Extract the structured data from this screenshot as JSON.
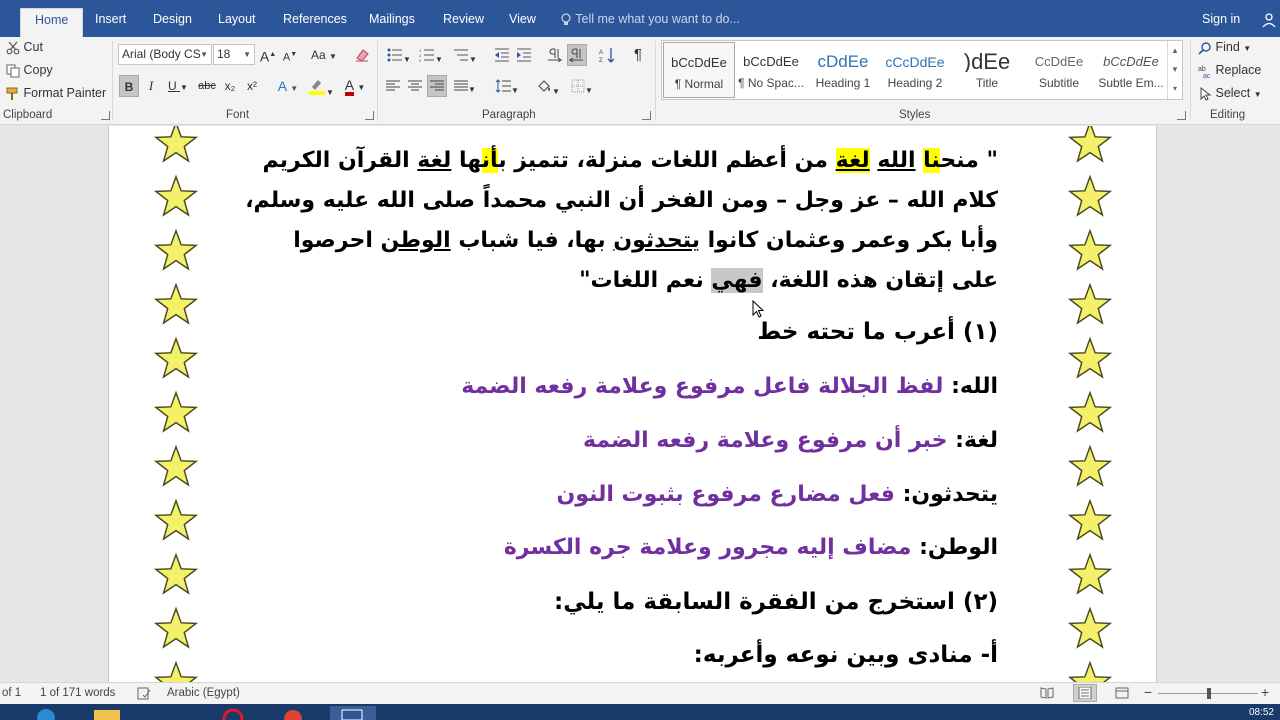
{
  "tabs": [
    {
      "label": "Home",
      "active": true
    },
    {
      "label": "Insert"
    },
    {
      "label": "Design"
    },
    {
      "label": "Layout"
    },
    {
      "label": "References"
    },
    {
      "label": "Mailings"
    },
    {
      "label": "Review"
    },
    {
      "label": "View"
    }
  ],
  "tell_me": "Tell me what you want to do...",
  "sign_in": "Sign in",
  "clipboard": {
    "cut": "Cut",
    "copy": "Copy",
    "format_painter": "Format Painter",
    "label": "Clipboard"
  },
  "font": {
    "name": "Arial (Body CS",
    "size": "18",
    "label": "Font",
    "bold": "B",
    "italic": "I",
    "underline": "U",
    "strike": "abc",
    "subscript": "x₂",
    "superscript": "x²",
    "case": "Aa",
    "grow": "A",
    "shrink": "A",
    "effects": "A",
    "color": "A",
    "highlight_color": "#ffff00",
    "font_color": "#c00000"
  },
  "paragraph": {
    "label": "Paragraph",
    "pilcrow": "¶"
  },
  "styles": {
    "label": "Styles",
    "items": [
      {
        "sample": "bCcDdEe",
        "name": "¶ Normal",
        "selected": true
      },
      {
        "sample": "bCcDdEe",
        "name": "¶ No Spac..."
      },
      {
        "sample": "cDdEe",
        "name": "Heading 1"
      },
      {
        "sample": "cCcDdEe",
        "name": "Heading 2"
      },
      {
        "sample": ")dEe",
        "name": "Title"
      },
      {
        "sample": "CcDdEe",
        "name": "Subtitle"
      },
      {
        "sample": "bCcDdEe",
        "name": "Subtle Em..."
      }
    ]
  },
  "editing": {
    "find": "Find",
    "replace": "Replace",
    "select": "Select",
    "label": "Editing"
  },
  "document": {
    "para1": [
      "\" منحنا الله لغة من أعظم اللغات منزلة، تتميز بأنها لغة القرآن الكريم",
      "كلام الله – عز وجل – ومن الفخر أن النبي محمداً صلى الله عليه وسلم،",
      "وأبا بكر وعمر وعثمان كانوا يتحدثون بها، فيا شباب الوطن احرصوا",
      "على إتقان هذه اللغة، فهي نعم اللغات\""
    ],
    "q1": "(١) أعرب ما تحته خط",
    "answers": [
      {
        "word": "الله:",
        "desc": "لفظ الجلالة فاعل مرفوع وعلامة رفعه الضمة"
      },
      {
        "word": "لغة:",
        "desc": "خبر أن مرفوع وعلامة رفعه الضمة"
      },
      {
        "word": "يتحدثون:",
        "desc": "فعل مضارع مرفوع بثبوت النون"
      },
      {
        "word": "الوطن:",
        "desc": "مضاف إليه مجرور وعلامة جره الكسرة"
      }
    ],
    "q2": "(٢) استخرج من الفقرة السابقة ما يلي:",
    "q2a": "أ- منادى وبين نوعه وأعربه:"
  },
  "status": {
    "page": "of 1",
    "words": "1 of 171 words",
    "language": "Arabic (Egypt)"
  },
  "clock": "08:52"
}
